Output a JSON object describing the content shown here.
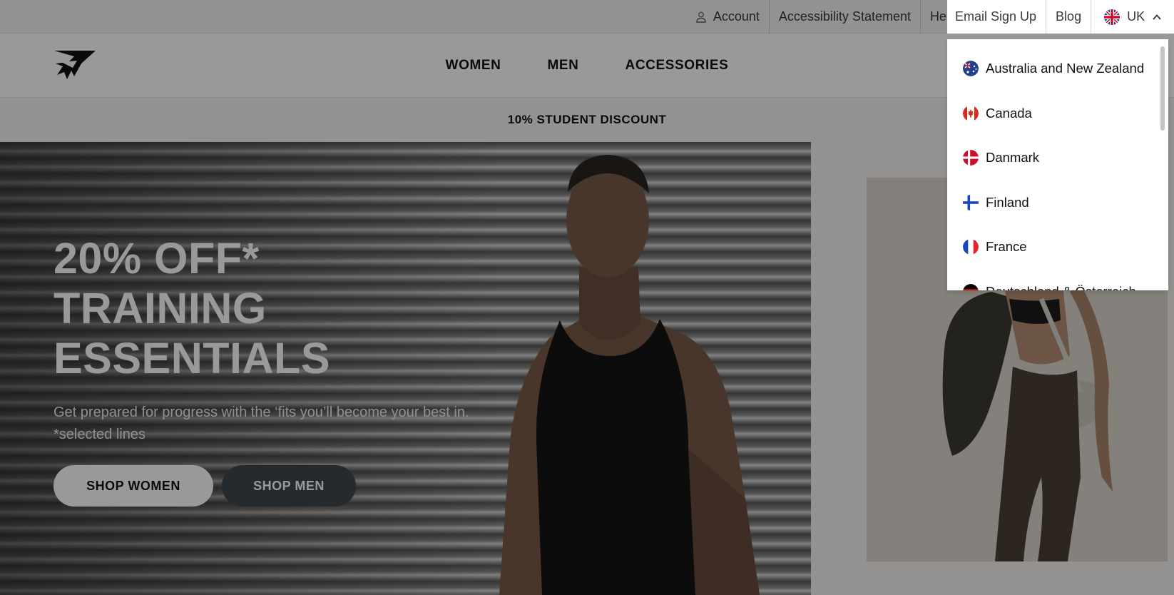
{
  "topbar": {
    "account_label": "Account",
    "accessibility_label": "Accessibility Statement",
    "help_label": "Help",
    "email_signup_label": "Email Sign Up",
    "blog_label": "Blog",
    "region_label": "UK"
  },
  "nav": {
    "items": [
      {
        "label": "WOMEN"
      },
      {
        "label": "MEN"
      },
      {
        "label": "ACCESSORIES"
      }
    ]
  },
  "promo": {
    "text": "10% STUDENT DISCOUNT"
  },
  "hero": {
    "title_lines": [
      "20% OFF*",
      "TRAINING",
      "ESSENTIALS"
    ],
    "subtitle": "Get prepared for progress with the ‘fits you’ll become your best in. *selected lines",
    "shop_women_label": "SHOP WOMEN",
    "shop_men_label": "SHOP MEN"
  },
  "region_dropdown": {
    "items": [
      {
        "label": "Australia and New Zealand",
        "flag": "flag-australia-icon"
      },
      {
        "label": "Canada",
        "flag": "flag-canada-icon"
      },
      {
        "label": "Danmark",
        "flag": "flag-denmark-icon"
      },
      {
        "label": "Finland",
        "flag": "flag-finland-icon"
      },
      {
        "label": "France",
        "flag": "flag-france-icon"
      },
      {
        "label": "Deutschland & Österreich",
        "flag": "flag-germany-icon"
      }
    ]
  },
  "colors": {
    "overlay": "#000000",
    "men_button": "#3f474f",
    "scrollbar": "#c4c4c4"
  }
}
